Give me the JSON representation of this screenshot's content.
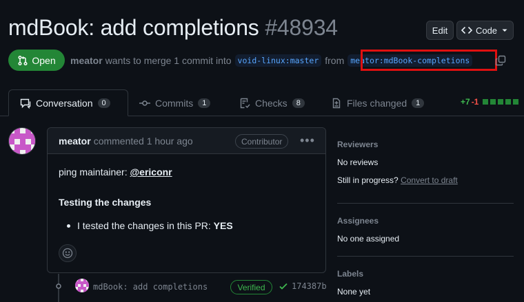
{
  "header": {
    "title": "mdBook: add completions",
    "number": "#48934",
    "edit_label": "Edit",
    "code_label": "Code"
  },
  "status": {
    "state": "Open",
    "author": "meator",
    "merge_text": "wants to merge 1 commit into",
    "base_branch": "void-linux:master",
    "from_text": "from",
    "head_branch": "meator:mdBook-completions"
  },
  "tabs": [
    {
      "label": "Conversation",
      "count": "0",
      "icon": "comment-icon"
    },
    {
      "label": "Commits",
      "count": "1",
      "icon": "git-commit-icon"
    },
    {
      "label": "Checks",
      "count": "8",
      "icon": "checklist-icon"
    },
    {
      "label": "Files changed",
      "count": "1",
      "icon": "file-diff-icon"
    }
  ],
  "diffstat": {
    "additions": "+7",
    "deletions": "-1"
  },
  "comment": {
    "author": "meator",
    "meta": "commented 1 hour ago",
    "badge": "Contributor",
    "ping_text": "ping maintainer: ",
    "mention": "@ericonr",
    "heading": "Testing the changes",
    "bullet_text": "I tested the changes in this PR: ",
    "bullet_value": "YES"
  },
  "commit": {
    "message": "mdBook: add completions",
    "verified": "Verified",
    "sha": "174387b"
  },
  "sidebar": {
    "reviewers_label": "Reviewers",
    "reviewers_value": "No reviews",
    "in_progress": "Still in progress?",
    "convert_draft": "Convert to draft",
    "assignees_label": "Assignees",
    "assignees_value": "No one assigned",
    "labels_label": "Labels",
    "labels_value": "None yet"
  },
  "colors": {
    "accent_green": "#238636",
    "link_blue": "#58a6ff",
    "highlight_red": "#e01010",
    "background": "#0d1117"
  }
}
